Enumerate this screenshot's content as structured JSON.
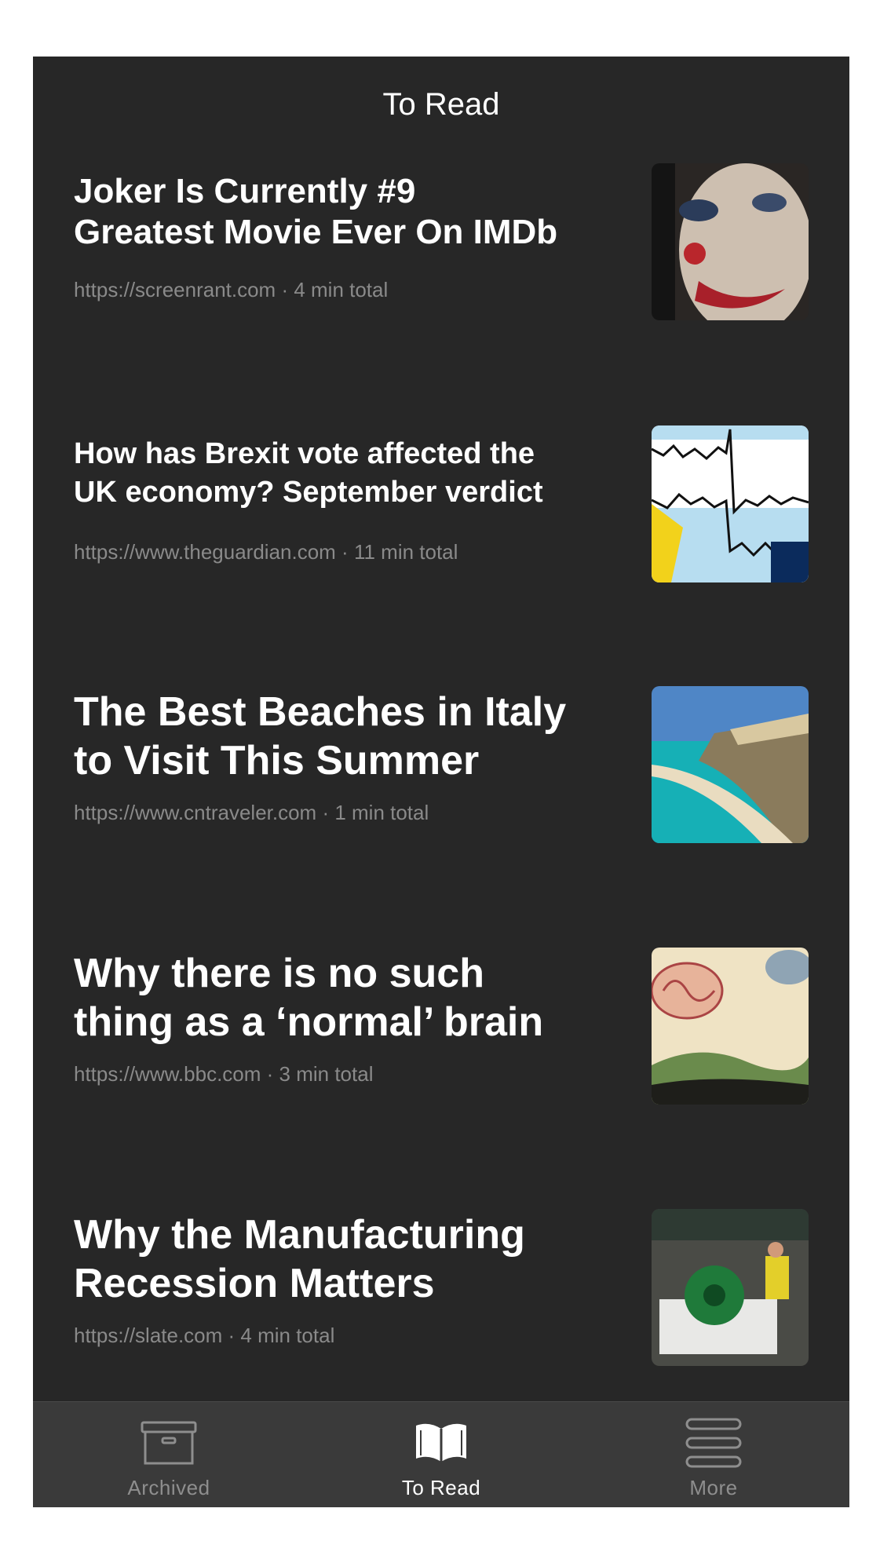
{
  "screen": {
    "title": "To Read"
  },
  "articles": [
    {
      "title_line1": "Joker Is Currently #9",
      "title_line2": "Greatest Movie Ever On IMDb",
      "meta": "https://screenrant.com · 4 min total",
      "thumbnail": "joker-face-image"
    },
    {
      "title_line1": "How has Brexit vote affected the",
      "title_line2": "UK economy? September verdict",
      "meta": "https://www.theguardian.com · 11 min total",
      "thumbnail": "economy-chart-image"
    },
    {
      "title_line1": "The Best Beaches in Italy",
      "title_line2": "to Visit This Summer",
      "meta": "https://www.cntraveler.com · 1 min total",
      "thumbnail": "beach-coastline-image"
    },
    {
      "title_line1": "Why there is no such",
      "title_line2": "thing as a ‘normal’ brain",
      "meta": "https://www.bbc.com · 3 min total",
      "thumbnail": "brain-illustration-image"
    },
    {
      "title_line1": "Why the Manufacturing",
      "title_line2": "Recession Matters",
      "meta": "https://slate.com · 4 min total",
      "thumbnail": "factory-worker-image"
    }
  ],
  "tab_bar": {
    "tabs": [
      {
        "label": "Archived",
        "icon": "archive-box-icon",
        "active": false
      },
      {
        "label": "To Read",
        "icon": "open-book-icon",
        "active": true
      },
      {
        "label": "More",
        "icon": "menu-lines-icon",
        "active": false
      }
    ]
  },
  "colors": {
    "background": "#272727",
    "tab_bar_bg": "#3a3a3a",
    "active_tab": "#ffffff",
    "inactive_tab": "#8e8e8e",
    "meta_text": "#8a8a8a"
  }
}
